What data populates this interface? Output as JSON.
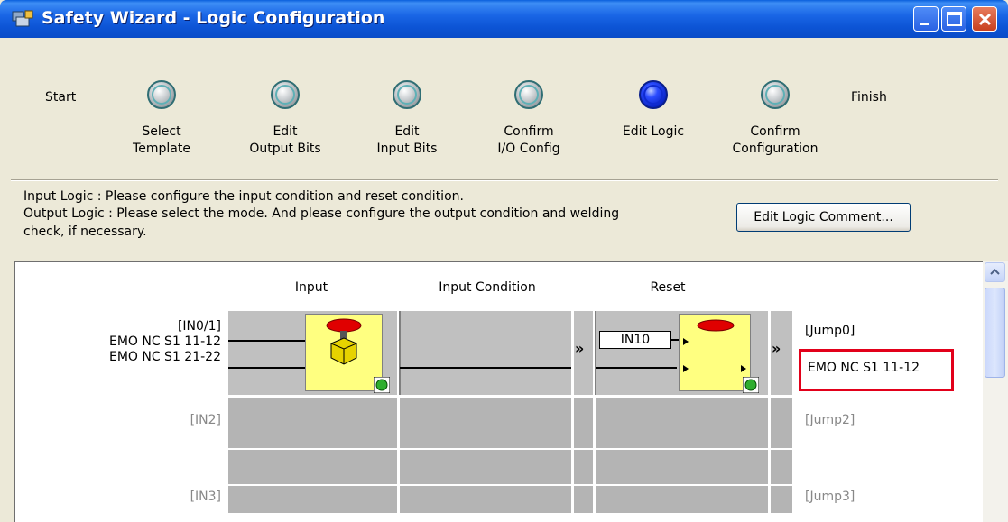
{
  "window": {
    "title": "Safety Wizard - Logic Configuration",
    "buttons": [
      "minimize",
      "maximize",
      "close"
    ]
  },
  "steps": {
    "start_label": "Start",
    "finish_label": "Finish",
    "items": [
      {
        "line1": "Select",
        "line2": "Template",
        "active": false
      },
      {
        "line1": "Edit",
        "line2": "Output Bits",
        "active": false
      },
      {
        "line1": "Edit",
        "line2": "Input Bits",
        "active": false
      },
      {
        "line1": "Confirm",
        "line2": "I/O Config",
        "active": false
      },
      {
        "line1": "Edit Logic",
        "line2": "",
        "active": true
      },
      {
        "line1": "Confirm",
        "line2": "Configuration",
        "active": false
      }
    ]
  },
  "instructions": {
    "line1": "Input Logic : Please configure the input condition and reset condition.",
    "line2": "Output Logic : Please select the mode. And please configure the output condition and welding",
    "line3": "check, if necessary."
  },
  "edit_logic_button": {
    "label": "Edit Logic Comment...",
    "mnemonic": "L"
  },
  "table": {
    "headers": {
      "input": "Input",
      "input_condition": "Input Condition",
      "reset": "Reset"
    },
    "rows": [
      {
        "input_id": "[IN0/1]",
        "input_line1": "EMO NC S1 11-12",
        "input_line2": "EMO NC S1 21-22",
        "reset_input": "IN10",
        "jump": "[Jump0]",
        "output": "EMO NC S1 11-12"
      },
      {
        "input_id": "[IN2]",
        "jump": "[Jump2]"
      },
      {
        "input_id": "[IN3]",
        "jump": "[Jump3]"
      }
    ]
  },
  "colors": {
    "highlight": "#e2001a",
    "active_step": "#1a2fe0",
    "titlebar": "#0a55d6"
  },
  "icons": [
    "app-icon",
    "emergency-stop-icon",
    "reset-button-icon",
    "green-status-icon",
    "expand-chevron-icon",
    "scroll-up-icon"
  ]
}
